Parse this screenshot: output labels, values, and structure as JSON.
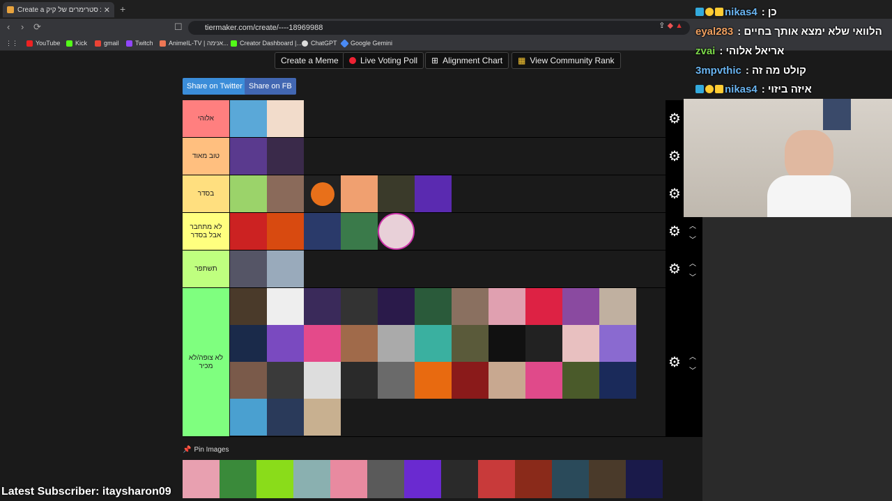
{
  "browser": {
    "tab_title": "Create a ריגוע סטרימרים של קיק",
    "url": "tiermaker.com/create/----18969988",
    "bookmarks": [
      "YouTube",
      "Kick",
      "gmail",
      "Twitch",
      "AnimeIL-TV | אנימה...",
      "Creator Dashboard |...",
      "ChatGPT",
      "Google Gemini"
    ]
  },
  "toolbar": {
    "create_meme": "Create a Meme",
    "live_voting": "Live Voting Poll",
    "alignment_chart": "Alignment Chart",
    "community_rank": "View Community Rank",
    "share_twitter": "Share on Twitter",
    "share_fb": "Share on FB"
  },
  "tiers": [
    {
      "label": "אלוהי",
      "color": "#ff7f7f"
    },
    {
      "label": "טוב מאוד",
      "color": "#ffbf7f"
    },
    {
      "label": "בסדר",
      "color": "#ffdf7f"
    },
    {
      "label": "לא מתחבר אבל בסדר",
      "color": "#ffff7f"
    },
    {
      "label": "תשתפר",
      "color": "#bfff7f"
    },
    {
      "label": "לא צופה/לא מכיר",
      "color": "#7fff7f"
    }
  ],
  "pin_images_label": "Pin Images",
  "overlay": {
    "latest_subscriber": "Latest Subscriber: itaysharon09"
  },
  "chat": [
    {
      "user": "nikas4",
      "message": "כן :"
    },
    {
      "user": "eyal283",
      "message": "הלוואי שלא ימצא אותך בחיים :"
    },
    {
      "user": "zvai",
      "message": "אריאל אלוהי :"
    },
    {
      "user": "3mpvthic",
      "message": "קולט מה זה :"
    },
    {
      "user": "nikas4",
      "message": "איזה ביזוי :"
    }
  ]
}
